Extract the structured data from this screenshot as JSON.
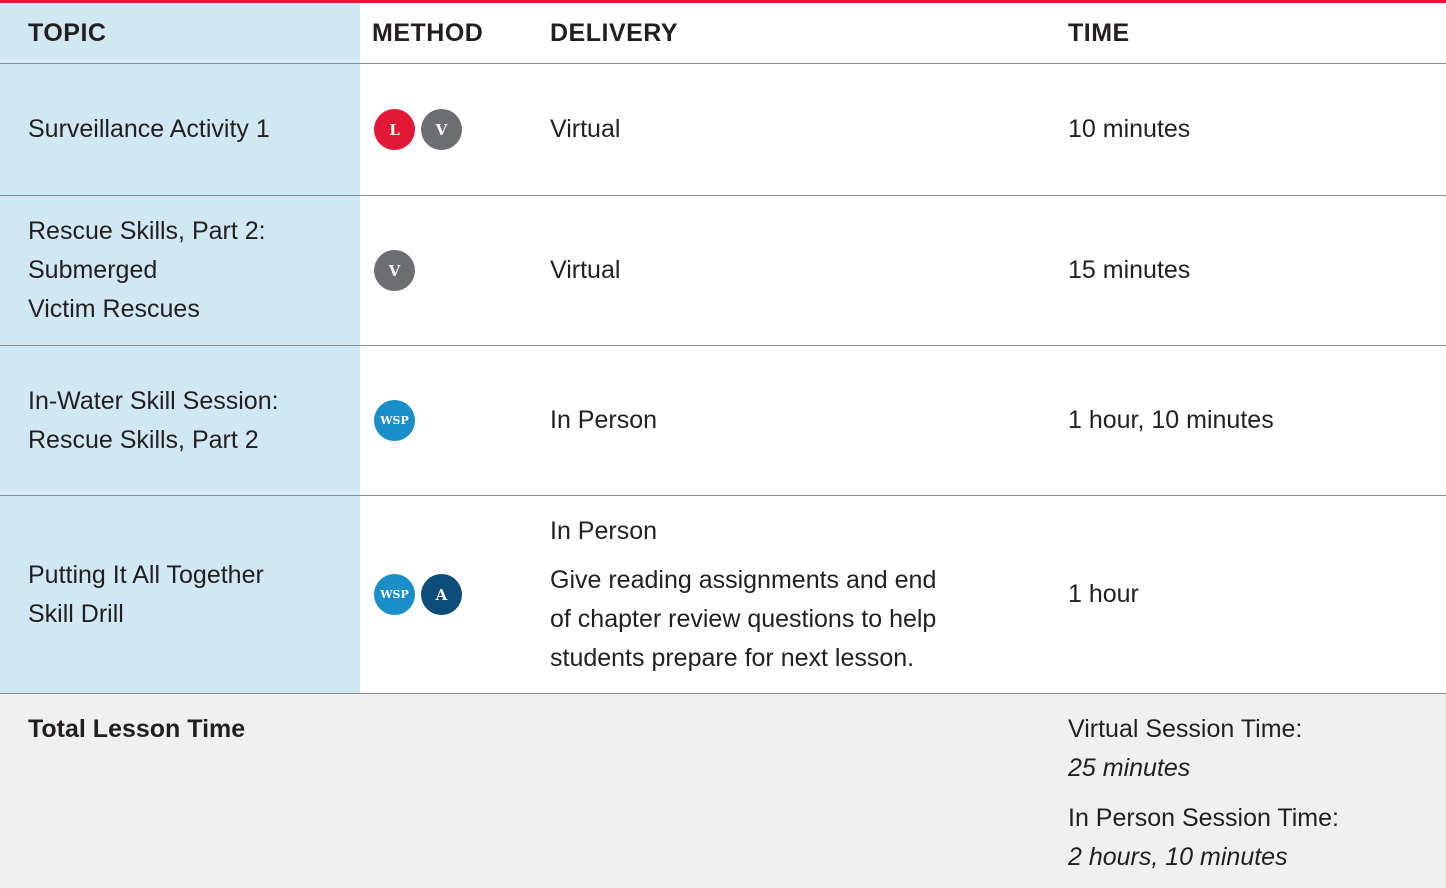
{
  "header": {
    "topic": "TOPIC",
    "method": "METHOD",
    "delivery": "DELIVERY",
    "time": "TIME"
  },
  "rows": [
    {
      "topic_lines": [
        "Surveillance Activity 1"
      ],
      "methods": [
        "L",
        "V"
      ],
      "delivery": "Virtual",
      "time": "10 minutes"
    },
    {
      "topic_lines": [
        "Rescue Skills, Part 2:",
        "Submerged",
        "Victim Rescues"
      ],
      "methods": [
        "V"
      ],
      "delivery": "Virtual",
      "time": "15 minutes"
    },
    {
      "topic_lines": [
        "In-Water Skill Session:",
        "Rescue Skills, Part 2"
      ],
      "methods": [
        "WSP"
      ],
      "delivery": "In Person",
      "time": "1 hour, 10 minutes"
    },
    {
      "topic_lines": [
        "Putting It All Together",
        "Skill Drill"
      ],
      "methods": [
        "WSP",
        "A"
      ],
      "delivery": "In Person",
      "delivery_note_lines": [
        "Give reading assignments and end",
        "of chapter review questions to help",
        "students prepare for next lesson."
      ],
      "time": "1 hour"
    }
  ],
  "total": {
    "label": "Total Lesson Time",
    "virtual_label": "Virtual Session Time:",
    "virtual_value": "25 minutes",
    "in_person_label": "In Person Session Time:",
    "in_person_value": "2 hours, 10 minutes"
  },
  "colors": {
    "accent_red": "#e31837",
    "topic_column_bg": "#d0e7f4",
    "badge_L": "#e31837",
    "badge_V": "#6d6e71",
    "badge_WSP": "#1a8ec9",
    "badge_A": "#0e4c7a",
    "total_bg": "#f0f0f0"
  }
}
